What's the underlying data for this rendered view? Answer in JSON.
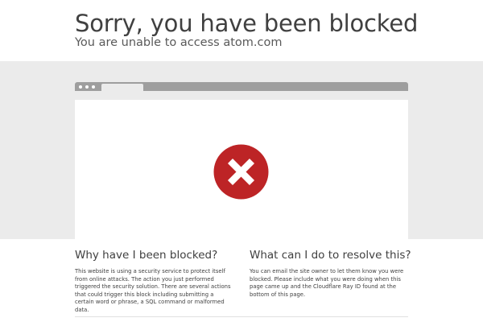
{
  "header": {
    "title": "Sorry, you have been blocked",
    "subtitle": "You are unable to access atom.com"
  },
  "illustration": {
    "icon": "blocked-x-icon",
    "icon_color": "#bd2426"
  },
  "why_blocked": {
    "heading": "Why have I been blocked?",
    "body": "This website is using a security service to protect itself from online attacks. The action you just performed triggered the security solution. There are several actions that could trigger this block including submitting a certain word or phrase, a SQL command or malformed data."
  },
  "resolve": {
    "heading": "What can I do to resolve this?",
    "body": "You can email the site owner to let them know you were blocked. Please include what you were doing when this page came up and the Cloudflare Ray ID found at the bottom of this page."
  }
}
